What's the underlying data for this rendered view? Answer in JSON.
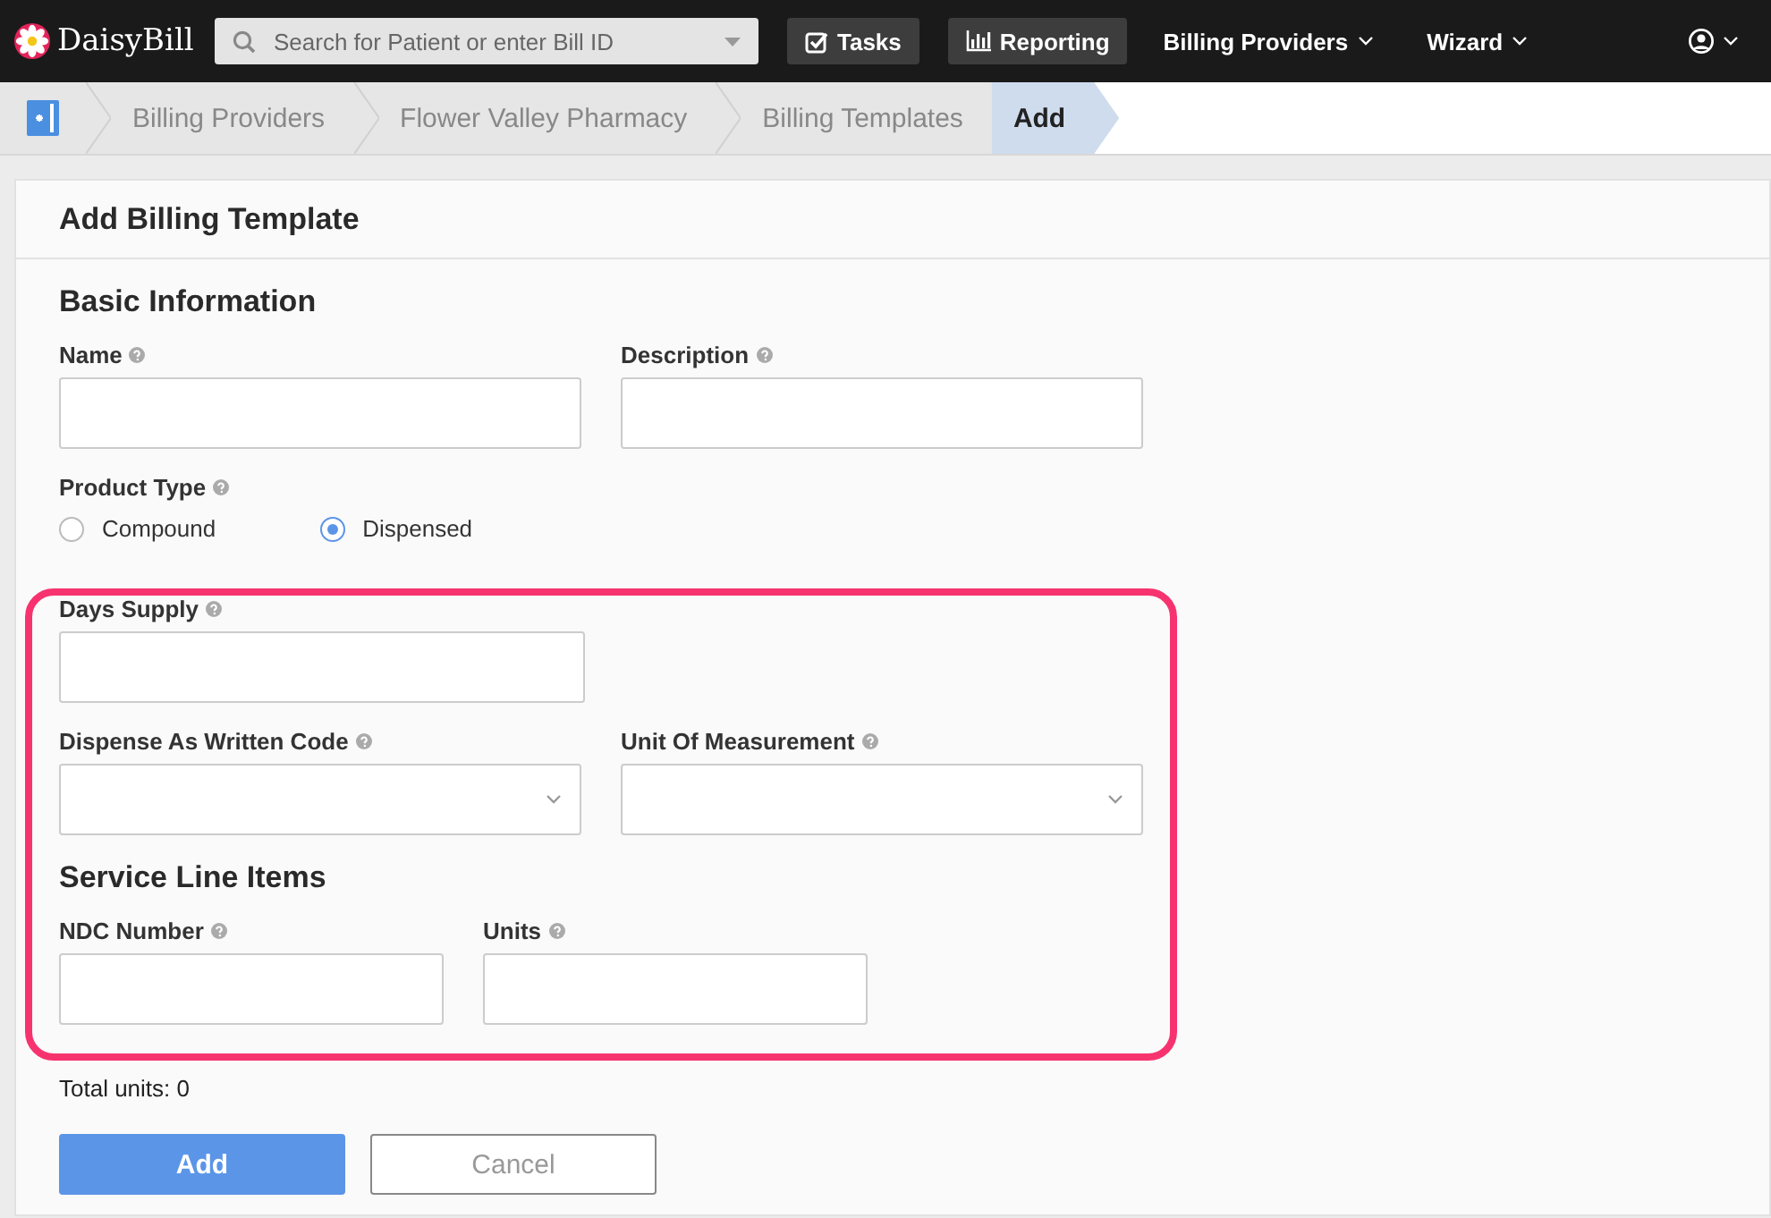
{
  "topbar": {
    "logo": "DaisyBill",
    "search": {
      "placeholder": "Search for Patient or enter Bill ID"
    },
    "nav": [
      {
        "label": "Tasks",
        "kind": "tasks"
      },
      {
        "label": "Reporting",
        "kind": "reports"
      },
      {
        "label": "Billing Providers",
        "kind": "menu"
      },
      {
        "label": "Wizard",
        "kind": "menu"
      }
    ]
  },
  "breadcrumbs": [
    {
      "label": "Billing Providers",
      "selected": false
    },
    {
      "label": "Flower Valley Pharmacy",
      "selected": false
    },
    {
      "label": "Billing Templates",
      "selected": false
    },
    {
      "label": "Add",
      "selected": true
    }
  ],
  "form": {
    "title": "Add Billing Template",
    "basic_items": [
      {
        "kind": "heading",
        "text": "Basic Information"
      },
      {
        "kind": "row",
        "fields": [
          {
            "label": "Name",
            "kind": "text"
          },
          {
            "label": "Description",
            "kind": "text"
          }
        ]
      },
      {
        "kind": "radio",
        "label": "Product Type",
        "options": [
          {
            "label": "Compound",
            "selected": false
          },
          {
            "label": "Dispensed",
            "selected": true
          }
        ]
      }
    ],
    "highlighted_items": [
      {
        "kind": "row",
        "fields": [
          {
            "label": "Days Supply",
            "kind": "text"
          }
        ]
      },
      {
        "kind": "row",
        "fields": [
          {
            "label": "Dispense As Written Code",
            "kind": "select"
          },
          {
            "label": "Unit Of Measurement",
            "kind": "select"
          }
        ]
      },
      {
        "kind": "heading",
        "text": "Service Line Items"
      },
      {
        "kind": "line-row",
        "fields": [
          {
            "label": "NDC Number",
            "kind": "text"
          },
          {
            "label": "Units",
            "kind": "text"
          }
        ]
      }
    ],
    "total": "Total units: 0",
    "buttons": [
      {
        "label": "Add",
        "kind": "primary"
      },
      {
        "label": "Cancel",
        "kind": "secondary"
      }
    ]
  }
}
